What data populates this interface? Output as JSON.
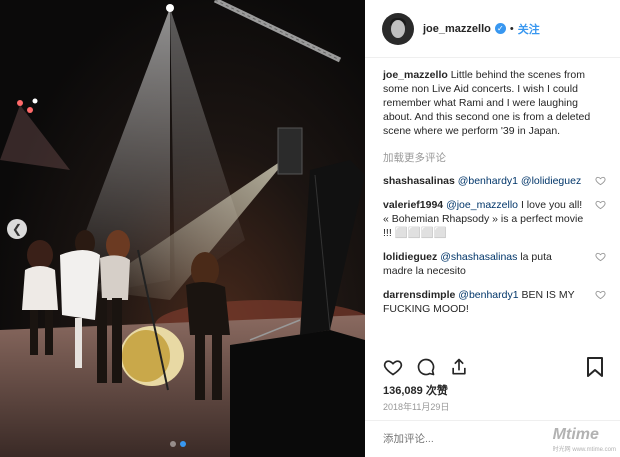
{
  "post": {
    "username": "joe_mazzello",
    "follow_label": "关注",
    "separator": "•",
    "caption_user": "joe_mazzello",
    "caption_text": "Little behind the scenes from some non Live Aid concerts. I wish I could remember what Rami and I were laughing about. And this second one is from a deleted scene where we perform '39 in Japan.",
    "load_more": "加载更多评论",
    "likes": "136,089 次赞",
    "date": "2018年11月29日",
    "add_comment_placeholder": "添加评论..."
  },
  "comments": [
    {
      "user": "shashasalinas",
      "mentions": "@benhardy1 @lolidieguez",
      "text": ""
    },
    {
      "user": "valerief1994",
      "mentions": "@joe_mazzello",
      "text": "I love you all! « Bohemian Rhapsody » is a perfect movie !!! ⬜⬜⬜⬜"
    },
    {
      "user": "lolidieguez",
      "mentions": "@shashasalinas",
      "text": "la puta madre la necesito"
    },
    {
      "user": "darrensdimple",
      "mentions": "@benhardy1",
      "text": "BEN IS MY FUCKING MOOD!"
    }
  ],
  "watermark": {
    "main": "Mtime",
    "sub": "时光网 www.mtime.com"
  },
  "colors": {
    "accent": "#3897f0",
    "mention": "#003569",
    "muted": "#999999"
  },
  "icons": [
    "heart-icon",
    "comment-icon",
    "share-icon",
    "bookmark-icon",
    "verified-icon",
    "chevron-left-icon"
  ]
}
